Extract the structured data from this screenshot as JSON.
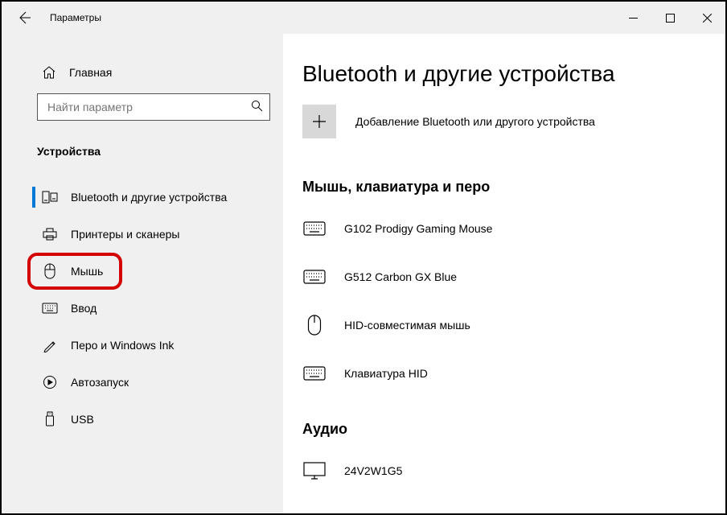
{
  "titlebar": {
    "title": "Параметры"
  },
  "sidebar": {
    "home_label": "Главная",
    "search_placeholder": "Найти параметр",
    "category_label": "Устройства",
    "items": [
      {
        "label": "Bluetooth и другие устройства"
      },
      {
        "label": "Принтеры и сканеры"
      },
      {
        "label": "Мышь"
      },
      {
        "label": "Ввод"
      },
      {
        "label": "Перо и Windows Ink"
      },
      {
        "label": "Автозапуск"
      },
      {
        "label": "USB"
      }
    ]
  },
  "main": {
    "page_title": "Bluetooth и другие устройства",
    "add_label": "Добавление Bluetooth или другого устройства",
    "section_mouse_kb": "Мышь, клавиатура и перо",
    "devices": [
      {
        "label": "G102 Prodigy Gaming Mouse"
      },
      {
        "label": "G512 Carbon GX Blue"
      },
      {
        "label": "HID-совместимая мышь"
      },
      {
        "label": "Клавиатура HID"
      }
    ],
    "section_audio": "Аудио",
    "audio_devices": [
      {
        "label": "24V2W1G5"
      }
    ]
  }
}
